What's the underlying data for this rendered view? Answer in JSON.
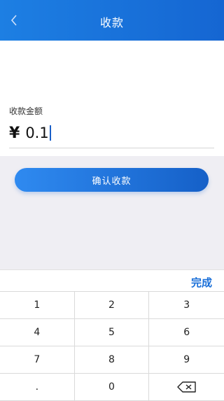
{
  "header": {
    "title": "收款"
  },
  "form": {
    "label": "收款金额",
    "currency_symbol": "¥",
    "amount": "0.1",
    "confirm_label": "确认收款"
  },
  "keyboard": {
    "done_label": "完成",
    "keys": [
      "1",
      "2",
      "3",
      "4",
      "5",
      "6",
      "7",
      "8",
      "9",
      ".",
      "0",
      ""
    ]
  },
  "colors": {
    "accent": "#1a6fd8",
    "header_start": "#1d7fe3",
    "header_end": "#1566d2"
  }
}
